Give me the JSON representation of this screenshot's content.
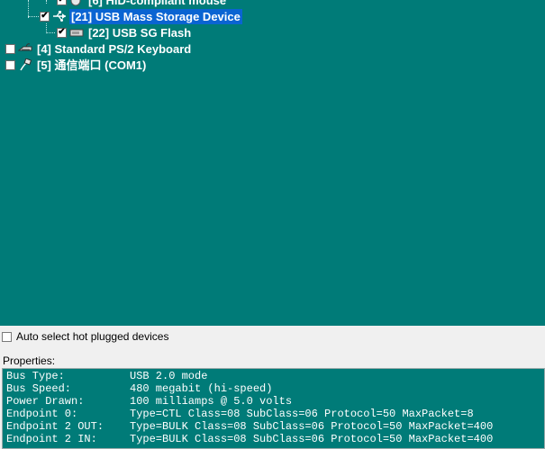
{
  "tree": {
    "items": [
      {
        "label": "[6] HID-compliant mouse",
        "checked": true,
        "icon": "mouse-icon"
      },
      {
        "label": "[21] USB Mass Storage Device",
        "checked": true,
        "icon": "usb-icon",
        "selected": true
      },
      {
        "label": "[22] USB SG Flash",
        "checked": true,
        "icon": "drive-icon"
      },
      {
        "label": "[4] Standard PS/2 Keyboard",
        "checked": false,
        "icon": "keyboard-icon"
      },
      {
        "label": "[5] 通信端口 (COM1)",
        "checked": false,
        "icon": "serial-port-icon"
      }
    ]
  },
  "auto_select": {
    "label": "Auto select hot plugged devices",
    "checked": false
  },
  "properties": {
    "label": "Properties:",
    "rows": [
      {
        "key": "Bus Type:",
        "value": "USB 2.0 mode"
      },
      {
        "key": "Bus Speed:",
        "value": "480 megabit (hi-speed)"
      },
      {
        "key": "Power Drawn:",
        "value": "100 milliamps @ 5.0 volts"
      },
      {
        "key": "Endpoint 0:",
        "value": "Type=CTL Class=08 SubClass=06 Protocol=50 MaxPacket=8"
      },
      {
        "key": "Endpoint 2 OUT:",
        "value": "Type=BULK Class=08 SubClass=06 Protocol=50 MaxPacket=400"
      },
      {
        "key": "Endpoint 2 IN:",
        "value": "Type=BULK Class=08 SubClass=06 Protocol=50 MaxPacket=400"
      }
    ]
  },
  "colors": {
    "pane_bg": "#007b78",
    "selection": "#0a64d2"
  }
}
